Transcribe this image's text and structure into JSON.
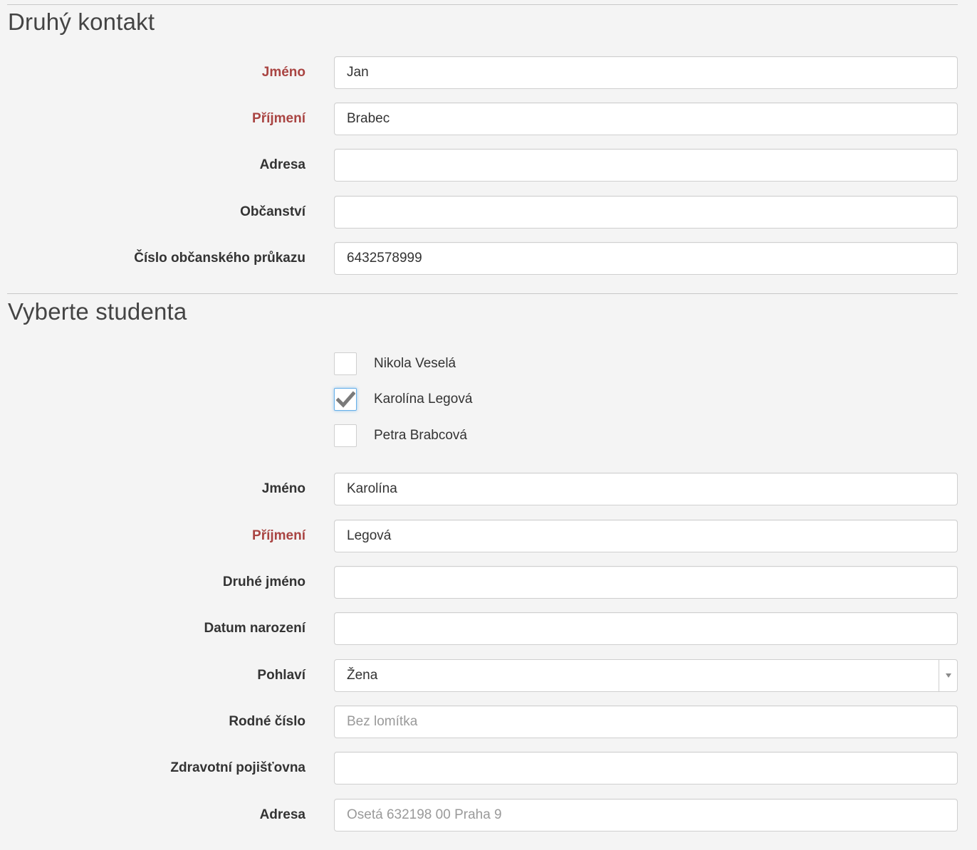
{
  "second_contact": {
    "title": "Druhý kontakt",
    "fields": [
      {
        "label": "Jméno",
        "value": "Jan",
        "placeholder": "",
        "required": true
      },
      {
        "label": "Příjmení",
        "value": "Brabec",
        "placeholder": "",
        "required": true
      },
      {
        "label": "Adresa",
        "value": "",
        "placeholder": "",
        "required": false
      },
      {
        "label": "Občanství",
        "value": "",
        "placeholder": "",
        "required": false
      },
      {
        "label": "Číslo občanského průkazu",
        "value": "6432578999",
        "placeholder": "",
        "required": false
      }
    ]
  },
  "student": {
    "title": "Vyberte studenta",
    "options": [
      {
        "label": "Nikola Veselá",
        "checked": false
      },
      {
        "label": "Karolína Legová",
        "checked": true
      },
      {
        "label": "Petra Brabcová",
        "checked": false
      }
    ],
    "fields": [
      {
        "label": "Jméno",
        "value": "Karolína",
        "placeholder": "",
        "required": false
      },
      {
        "label": "Příjmení",
        "value": "Legová",
        "placeholder": "",
        "required": true
      },
      {
        "label": "Druhé jméno",
        "value": "",
        "placeholder": "",
        "required": false
      },
      {
        "label": "Datum narození",
        "value": "",
        "placeholder": "",
        "required": false
      }
    ],
    "gender": {
      "label": "Pohlaví",
      "value": "Žena"
    },
    "fields2": [
      {
        "label": "Rodné číslo",
        "value": "",
        "placeholder": "Bez lomítka",
        "required": false
      },
      {
        "label": "Zdravotní pojišťovna",
        "value": "",
        "placeholder": "",
        "required": false
      },
      {
        "label": "Adresa",
        "value": "",
        "placeholder": "Osetá 632198 00 Praha 9",
        "required": false
      }
    ]
  },
  "colors": {
    "required_label": "#a94442",
    "focus_border": "#66afe9",
    "background": "#f4f4f4"
  }
}
